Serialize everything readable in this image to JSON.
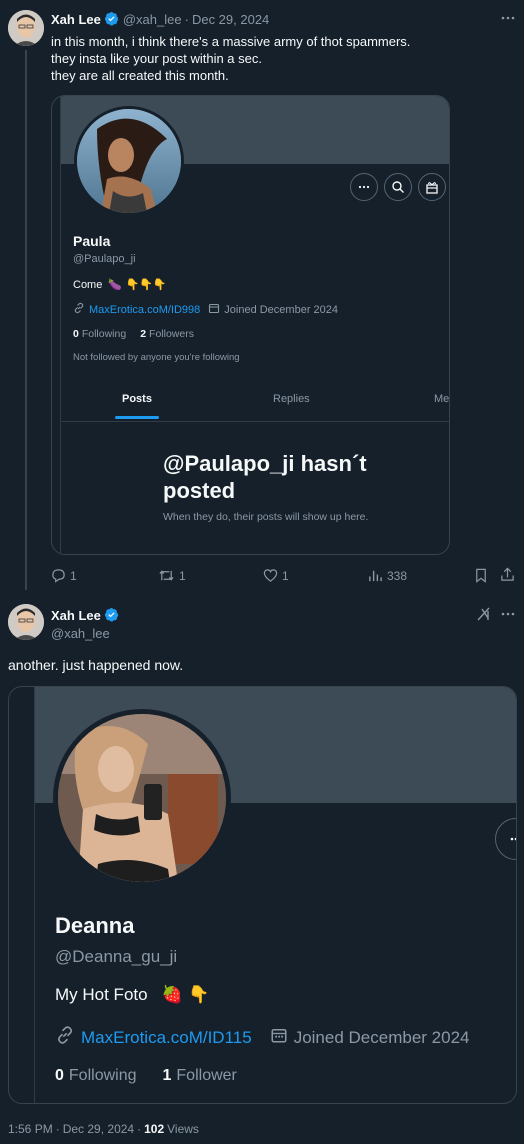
{
  "tweet1": {
    "author_name": "Xah Lee",
    "handle": "@xah_lee",
    "separator": "·",
    "date": "Dec 29, 2024",
    "more_icon": "more-dots-icon",
    "lines": [
      "in this month, i think there's a massive army of thot spammers.",
      "they insta like your post within a sec.",
      "they are all created this month."
    ],
    "embedded_profile": {
      "name": "Paula",
      "handle": "@Paulapo_ji",
      "bio_text": "Come",
      "bio_emoji": "🍆 👇👇👇",
      "link": "MaxErotica.coM/ID998",
      "joined": "Joined December 2024",
      "following_count": "0",
      "following_label": "Following",
      "followers_count": "2",
      "followers_label": "Followers",
      "followed_note": "Not followed by anyone you're following",
      "tabs": [
        "Posts",
        "Replies",
        "Me"
      ],
      "empty_title": "@Paulapo_ji hasn´t posted",
      "empty_sub": "When they do, their posts will show up here."
    },
    "actions": {
      "replies": "1",
      "reposts": "1",
      "likes": "1",
      "views": "338"
    }
  },
  "tweet2": {
    "author_name": "Xah Lee",
    "handle": "@xah_lee",
    "text": "another. just happened now.",
    "grok_icon": "grok-icon",
    "embedded_profile": {
      "name": "Deanna",
      "handle": "@Deanna_gu_ji",
      "bio_text": "My Hot Foto",
      "bio_emoji": "🍓 👇",
      "link": "MaxErotica.coM/ID115",
      "joined": "Joined December 2024",
      "following_count": "0",
      "following_label": "Following",
      "followers_count": "1",
      "followers_label": "Follower"
    },
    "footer": {
      "time": "1:56 PM",
      "date": "Dec 29, 2024",
      "separator": "·",
      "views_count": "102",
      "views_label": "Views"
    }
  },
  "colors": {
    "background": "#15202b",
    "accent": "#1d9bf0",
    "muted": "#8b98a5",
    "banner": "#3d4b57",
    "border": "#38444d"
  }
}
